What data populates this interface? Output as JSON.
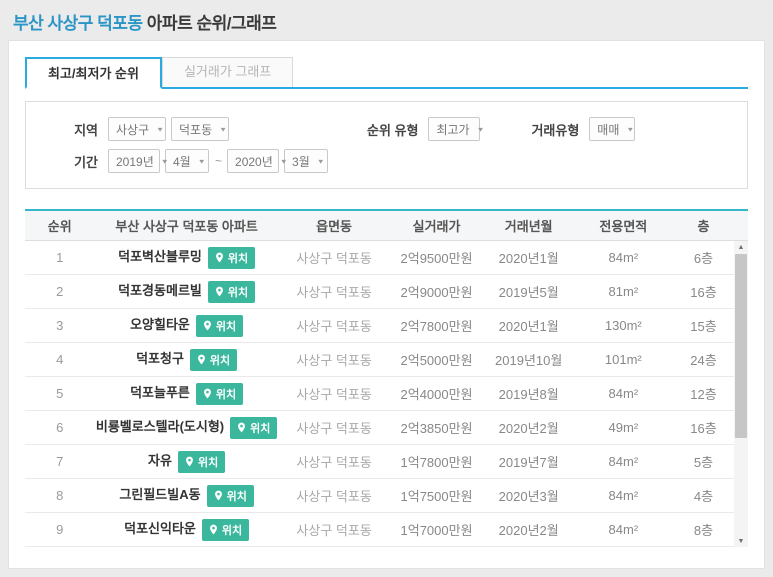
{
  "header": {
    "title_highlight": "부산 사상구 덕포동",
    "title_rest": " 아파트 순위/그래프"
  },
  "tabs": [
    {
      "label": "최고/최저가 순위",
      "active": true
    },
    {
      "label": "실거래가 그래프",
      "active": false
    }
  ],
  "filters": {
    "region_label": "지역",
    "region_gu": "사상구",
    "region_dong": "덕포동",
    "rank_type_label": "순위 유형",
    "rank_type_value": "최고가",
    "trade_type_label": "거래유형",
    "trade_type_value": "매매",
    "period_label": "기간",
    "period_start_year": "2019년",
    "period_start_month": "4월",
    "period_separator": "~",
    "period_end_year": "2020년",
    "period_end_month": "3월"
  },
  "table": {
    "headers": [
      "순위",
      "부산 사상구 덕포동 아파트",
      "읍면동",
      "실거래가",
      "거래년월",
      "전용면적",
      "층"
    ],
    "location_badge_label": "위치",
    "rows": [
      {
        "rank": "1",
        "name": "덕포벽산블루밍",
        "dong": "사상구 덕포동",
        "price": "2억9500만원",
        "date": "2020년1월",
        "area": "84m²",
        "floor": "6층"
      },
      {
        "rank": "2",
        "name": "덕포경동메르빌",
        "dong": "사상구 덕포동",
        "price": "2억9000만원",
        "date": "2019년5월",
        "area": "81m²",
        "floor": "16층"
      },
      {
        "rank": "3",
        "name": "오양힐타운",
        "dong": "사상구 덕포동",
        "price": "2억7800만원",
        "date": "2020년1월",
        "area": "130m²",
        "floor": "15층"
      },
      {
        "rank": "4",
        "name": "덕포청구",
        "dong": "사상구 덕포동",
        "price": "2억5000만원",
        "date": "2019년10월",
        "area": "101m²",
        "floor": "24층"
      },
      {
        "rank": "5",
        "name": "덕포늘푸른",
        "dong": "사상구 덕포동",
        "price": "2억4000만원",
        "date": "2019년8월",
        "area": "84m²",
        "floor": "12층"
      },
      {
        "rank": "6",
        "name": "비룡벨로스텔라(도시형)",
        "dong": "사상구 덕포동",
        "price": "2억3850만원",
        "date": "2020년2월",
        "area": "49m²",
        "floor": "16층"
      },
      {
        "rank": "7",
        "name": "자유",
        "dong": "사상구 덕포동",
        "price": "1억7800만원",
        "date": "2019년7월",
        "area": "84m²",
        "floor": "5층"
      },
      {
        "rank": "8",
        "name": "그린필드빌A동",
        "dong": "사상구 덕포동",
        "price": "1억7500만원",
        "date": "2020년3월",
        "area": "84m²",
        "floor": "4층"
      },
      {
        "rank": "9",
        "name": "덕포신익타운",
        "dong": "사상구 덕포동",
        "price": "1억7000만원",
        "date": "2020년2월",
        "area": "84m²",
        "floor": "8층"
      }
    ]
  },
  "icons": {
    "select_arrow": "▼",
    "scroll_up": "▲",
    "scroll_down": "▼"
  },
  "colors": {
    "title_blue": "#2b96c6",
    "tab_accent": "#29abe2",
    "table_accent": "#35b6c9",
    "badge_green": "#3bb79d",
    "page_background": "#ebebeb"
  }
}
